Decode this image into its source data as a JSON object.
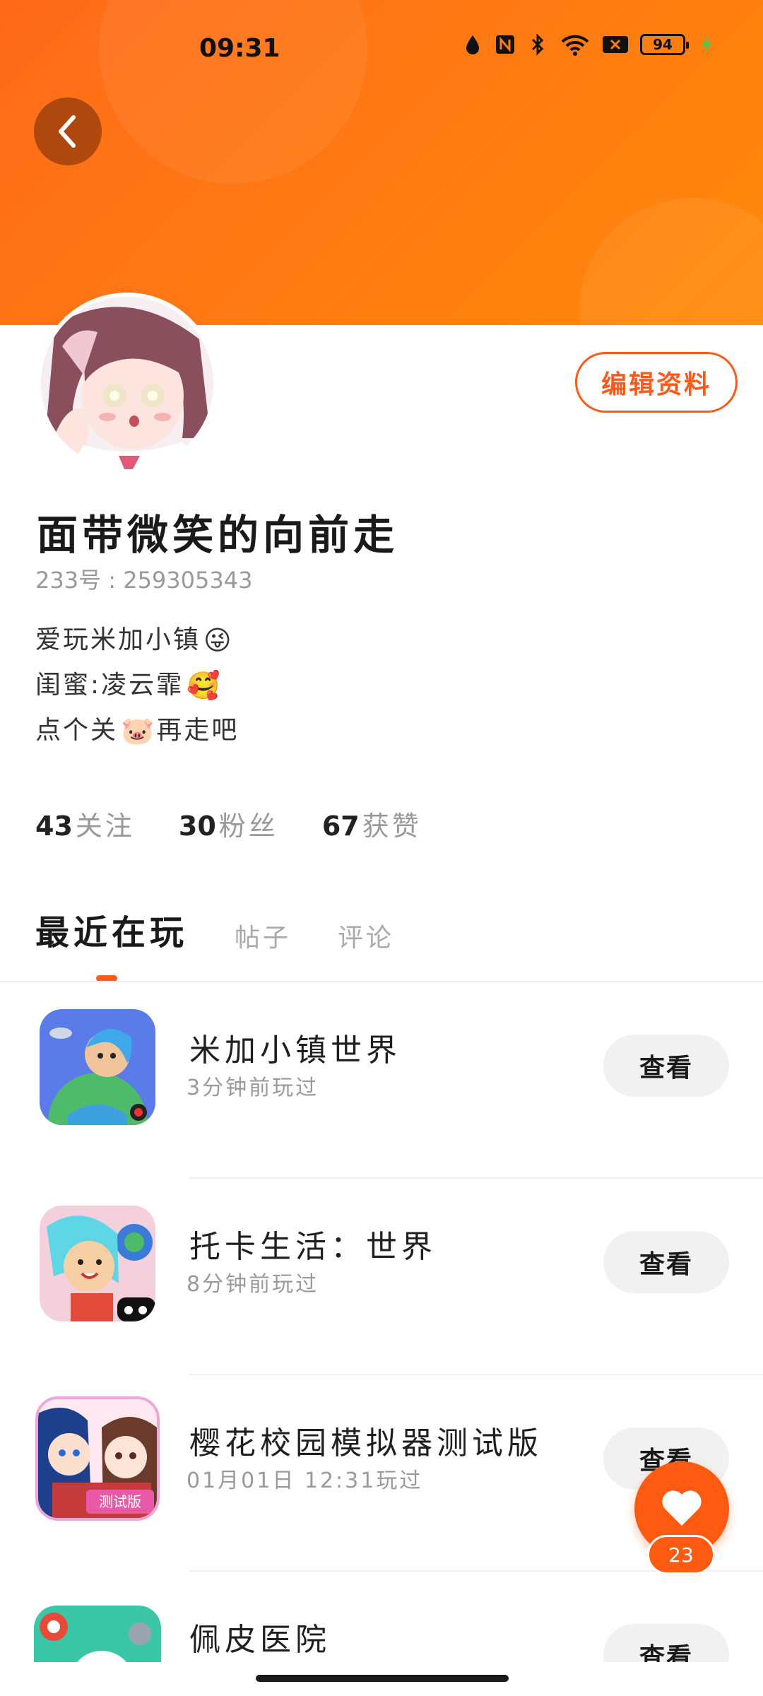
{
  "status_bar": {
    "time": "09:31",
    "battery": "94",
    "icons": [
      "droplet-icon",
      "nfc-icon",
      "bluetooth-icon",
      "wifi-icon",
      "sim-off-icon",
      "battery-icon",
      "charging-icon"
    ]
  },
  "colors": {
    "accent": "#ff5a1a",
    "header_start": "#ff6a1a",
    "header_end": "#ff8a0a"
  },
  "profile": {
    "name": "面带微笑的向前走",
    "uid": "233号 : 259305343",
    "edit_label": "编辑资料",
    "bio": [
      {
        "text": "爱玩米加小镇",
        "emoji": "😜"
      },
      {
        "text": "闺蜜:凌云霏",
        "emoji": "🥰"
      },
      {
        "text": "点个关",
        "emoji": "🐷",
        "suffix": "再走吧"
      }
    ],
    "stats": [
      {
        "num": "43",
        "label": "关注"
      },
      {
        "num": "30",
        "label": "粉丝"
      },
      {
        "num": "67",
        "label": "获赞"
      }
    ]
  },
  "tabs": [
    {
      "label": "最近在玩",
      "active": true
    },
    {
      "label": "帖子",
      "active": false
    },
    {
      "label": "评论",
      "active": false
    }
  ],
  "games": [
    {
      "title": "米加小镇世界",
      "time": "3分钟前玩过",
      "button": "查看"
    },
    {
      "title": "托卡生活：世界",
      "time": "8分钟前玩过",
      "button": "查看"
    },
    {
      "title": "樱花校园模拟器测试版",
      "time": "01月01日 12:31玩过",
      "button": "查看"
    },
    {
      "title": "佩皮医院",
      "time": "",
      "button": "查看"
    }
  ],
  "fab": {
    "count": "23"
  }
}
